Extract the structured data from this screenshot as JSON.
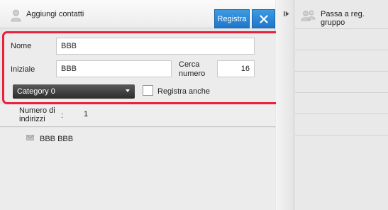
{
  "header": {
    "title": "Aggiungi contatti",
    "save_label": "Registra",
    "close_icon": "close-icon",
    "person_icon": "person-icon"
  },
  "form": {
    "name_label": "Nome",
    "name_value": "BBB",
    "initial_label": "Iniziale",
    "initial_value": "BBB",
    "number_label_line1": "Cerca",
    "number_label_line2": "numero",
    "number_value": "16",
    "category_selected": "Category 0",
    "register_also_label": "Registra anche",
    "register_also_checked": false
  },
  "address_count": {
    "label_line1": "Numero di",
    "label_line2": "indirizzi",
    "separator": ":",
    "value": "1"
  },
  "address_list": [
    {
      "icon": "mail-icon",
      "text": "BBB BBB"
    }
  ],
  "group_panel": {
    "title_line1": "Passa a reg.",
    "title_line2": "gruppo",
    "icon": "group-icon"
  },
  "colors": {
    "accent_blue": "#2784d6",
    "highlight_red": "#e8213f",
    "dropdown_dark": "#3a3a3a"
  }
}
